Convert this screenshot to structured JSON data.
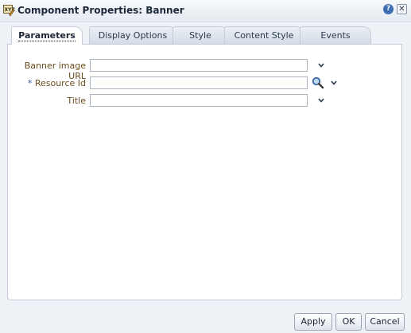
{
  "window": {
    "title": "Component Properties: Banner",
    "help_label": "?",
    "close_label": "✕"
  },
  "tabs": [
    {
      "label": "Parameters",
      "active": true
    },
    {
      "label": "Display Options",
      "active": false
    },
    {
      "label": "Style",
      "active": false
    },
    {
      "label": "Content Style",
      "active": false
    },
    {
      "label": "Events",
      "active": false
    }
  ],
  "form": {
    "banner_image_url": {
      "label": "Banner image URL",
      "value": ""
    },
    "resource_id": {
      "required_mark": "*",
      "label": "Resource Id",
      "value": ""
    },
    "title": {
      "label": "Title",
      "value": ""
    }
  },
  "footer": {
    "apply_label": "Apply",
    "ok_label": "OK",
    "cancel_label": "Cancel"
  }
}
